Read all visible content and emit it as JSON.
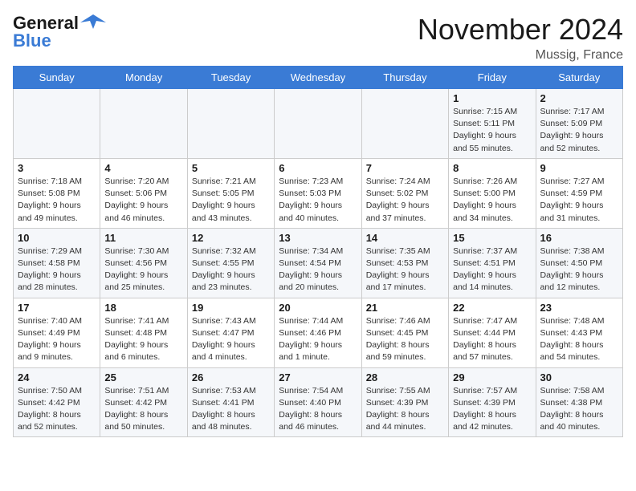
{
  "header": {
    "logo_line1": "General",
    "logo_line2": "Blue",
    "month": "November 2024",
    "location": "Mussig, France"
  },
  "weekdays": [
    "Sunday",
    "Monday",
    "Tuesday",
    "Wednesday",
    "Thursday",
    "Friday",
    "Saturday"
  ],
  "weeks": [
    [
      {
        "day": "",
        "info": ""
      },
      {
        "day": "",
        "info": ""
      },
      {
        "day": "",
        "info": ""
      },
      {
        "day": "",
        "info": ""
      },
      {
        "day": "",
        "info": ""
      },
      {
        "day": "1",
        "info": "Sunrise: 7:15 AM\nSunset: 5:11 PM\nDaylight: 9 hours\nand 55 minutes."
      },
      {
        "day": "2",
        "info": "Sunrise: 7:17 AM\nSunset: 5:09 PM\nDaylight: 9 hours\nand 52 minutes."
      }
    ],
    [
      {
        "day": "3",
        "info": "Sunrise: 7:18 AM\nSunset: 5:08 PM\nDaylight: 9 hours\nand 49 minutes."
      },
      {
        "day": "4",
        "info": "Sunrise: 7:20 AM\nSunset: 5:06 PM\nDaylight: 9 hours\nand 46 minutes."
      },
      {
        "day": "5",
        "info": "Sunrise: 7:21 AM\nSunset: 5:05 PM\nDaylight: 9 hours\nand 43 minutes."
      },
      {
        "day": "6",
        "info": "Sunrise: 7:23 AM\nSunset: 5:03 PM\nDaylight: 9 hours\nand 40 minutes."
      },
      {
        "day": "7",
        "info": "Sunrise: 7:24 AM\nSunset: 5:02 PM\nDaylight: 9 hours\nand 37 minutes."
      },
      {
        "day": "8",
        "info": "Sunrise: 7:26 AM\nSunset: 5:00 PM\nDaylight: 9 hours\nand 34 minutes."
      },
      {
        "day": "9",
        "info": "Sunrise: 7:27 AM\nSunset: 4:59 PM\nDaylight: 9 hours\nand 31 minutes."
      }
    ],
    [
      {
        "day": "10",
        "info": "Sunrise: 7:29 AM\nSunset: 4:58 PM\nDaylight: 9 hours\nand 28 minutes."
      },
      {
        "day": "11",
        "info": "Sunrise: 7:30 AM\nSunset: 4:56 PM\nDaylight: 9 hours\nand 25 minutes."
      },
      {
        "day": "12",
        "info": "Sunrise: 7:32 AM\nSunset: 4:55 PM\nDaylight: 9 hours\nand 23 minutes."
      },
      {
        "day": "13",
        "info": "Sunrise: 7:34 AM\nSunset: 4:54 PM\nDaylight: 9 hours\nand 20 minutes."
      },
      {
        "day": "14",
        "info": "Sunrise: 7:35 AM\nSunset: 4:53 PM\nDaylight: 9 hours\nand 17 minutes."
      },
      {
        "day": "15",
        "info": "Sunrise: 7:37 AM\nSunset: 4:51 PM\nDaylight: 9 hours\nand 14 minutes."
      },
      {
        "day": "16",
        "info": "Sunrise: 7:38 AM\nSunset: 4:50 PM\nDaylight: 9 hours\nand 12 minutes."
      }
    ],
    [
      {
        "day": "17",
        "info": "Sunrise: 7:40 AM\nSunset: 4:49 PM\nDaylight: 9 hours\nand 9 minutes."
      },
      {
        "day": "18",
        "info": "Sunrise: 7:41 AM\nSunset: 4:48 PM\nDaylight: 9 hours\nand 6 minutes."
      },
      {
        "day": "19",
        "info": "Sunrise: 7:43 AM\nSunset: 4:47 PM\nDaylight: 9 hours\nand 4 minutes."
      },
      {
        "day": "20",
        "info": "Sunrise: 7:44 AM\nSunset: 4:46 PM\nDaylight: 9 hours\nand 1 minute."
      },
      {
        "day": "21",
        "info": "Sunrise: 7:46 AM\nSunset: 4:45 PM\nDaylight: 8 hours\nand 59 minutes."
      },
      {
        "day": "22",
        "info": "Sunrise: 7:47 AM\nSunset: 4:44 PM\nDaylight: 8 hours\nand 57 minutes."
      },
      {
        "day": "23",
        "info": "Sunrise: 7:48 AM\nSunset: 4:43 PM\nDaylight: 8 hours\nand 54 minutes."
      }
    ],
    [
      {
        "day": "24",
        "info": "Sunrise: 7:50 AM\nSunset: 4:42 PM\nDaylight: 8 hours\nand 52 minutes."
      },
      {
        "day": "25",
        "info": "Sunrise: 7:51 AM\nSunset: 4:42 PM\nDaylight: 8 hours\nand 50 minutes."
      },
      {
        "day": "26",
        "info": "Sunrise: 7:53 AM\nSunset: 4:41 PM\nDaylight: 8 hours\nand 48 minutes."
      },
      {
        "day": "27",
        "info": "Sunrise: 7:54 AM\nSunset: 4:40 PM\nDaylight: 8 hours\nand 46 minutes."
      },
      {
        "day": "28",
        "info": "Sunrise: 7:55 AM\nSunset: 4:39 PM\nDaylight: 8 hours\nand 44 minutes."
      },
      {
        "day": "29",
        "info": "Sunrise: 7:57 AM\nSunset: 4:39 PM\nDaylight: 8 hours\nand 42 minutes."
      },
      {
        "day": "30",
        "info": "Sunrise: 7:58 AM\nSunset: 4:38 PM\nDaylight: 8 hours\nand 40 minutes."
      }
    ]
  ]
}
